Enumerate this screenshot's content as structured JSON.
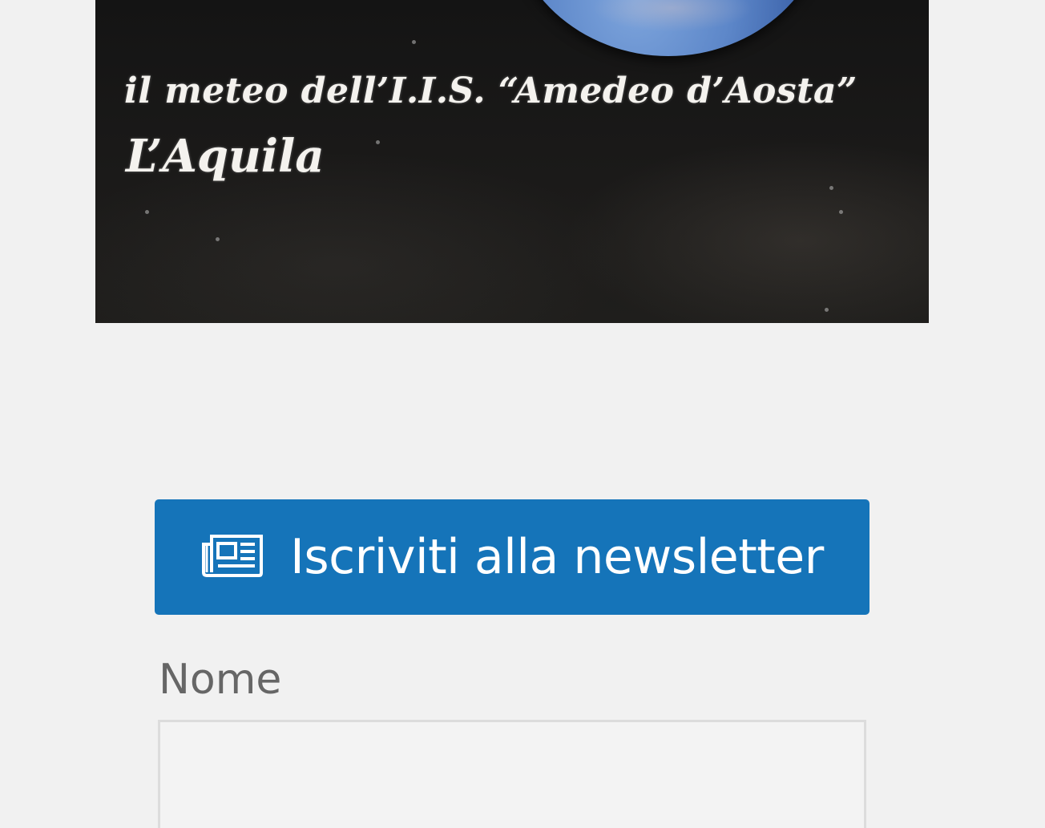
{
  "banner": {
    "subtitle": "il meteo dell’I.I.S. “Amedeo d’Aosta”",
    "city": "L’Aquila"
  },
  "newsletter": {
    "icon": "newspaper-icon",
    "label": "Iscriviti alla newsletter",
    "color": "#1574b9"
  },
  "form": {
    "name_label": "Nome",
    "name_value": "",
    "name_placeholder": ""
  }
}
